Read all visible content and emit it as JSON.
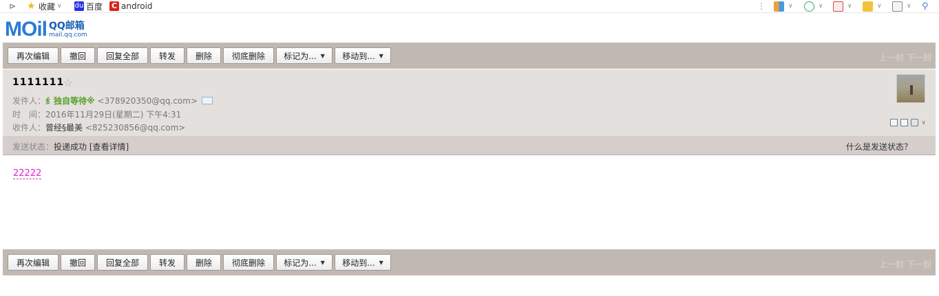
{
  "bookmarks": {
    "items": [
      {
        "label": "收藏",
        "icon": "star-icon"
      },
      {
        "label": "百度",
        "icon": "baidu-paw-icon"
      },
      {
        "label": "android",
        "icon": "c-logo-icon"
      }
    ]
  },
  "logo": {
    "mail": "MOil",
    "qq": "QQ邮箱",
    "url": "mail.qq.com"
  },
  "toolbar": {
    "buttons": [
      "再次编辑",
      "撤回",
      "回复全部",
      "转发",
      "删除",
      "彻底删除",
      "标记为...",
      "移动到..."
    ],
    "pager": "上一封 下一封"
  },
  "mail": {
    "subject": "1111111",
    "sender_label": "发件人：",
    "sender_name": "纟独自等待※",
    "sender_email": "<378920350@qq.com>",
    "time_label": "时　间：",
    "time_value": "2016年11月29日(星期二) 下午4:31",
    "recipient_label": "收件人：",
    "recipient_name": "曾经§最美",
    "recipient_email": "<825230856@qq.com>",
    "status_label": "发送状态：",
    "status_value": "投递成功",
    "status_detail": "[查看详情]",
    "status_help": "什么是发送状态？",
    "body": "22222"
  },
  "colors": {
    "toolbar_bg": "#c2b8b2",
    "header_bg": "#e4e0dd",
    "sender_green": "#58a12a",
    "body_magenta": "#e31ed8",
    "logo_blue": "#2a7bd4"
  }
}
